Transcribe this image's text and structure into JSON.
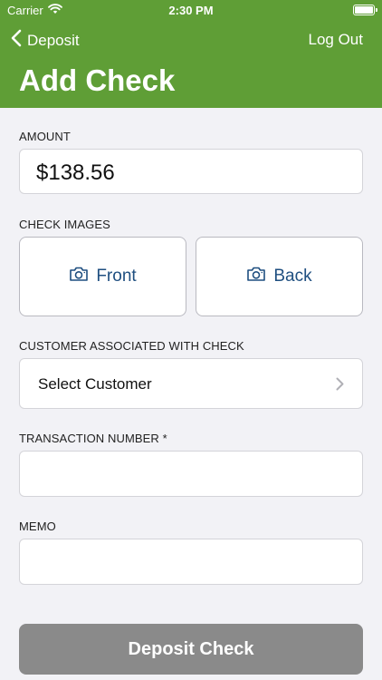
{
  "status_bar": {
    "carrier": "Carrier",
    "time": "2:30 PM"
  },
  "nav": {
    "back_label": "Deposit",
    "logout_label": "Log Out"
  },
  "page": {
    "title": "Add Check"
  },
  "amount": {
    "label": "AMOUNT",
    "value": "$138.56"
  },
  "check_images": {
    "label": "CHECK IMAGES",
    "front_label": "Front",
    "back_label": "Back"
  },
  "customer": {
    "label": "CUSTOMER ASSOCIATED WITH CHECK",
    "select_label": "Select Customer"
  },
  "transaction": {
    "label": "TRANSACTION NUMBER *",
    "value": ""
  },
  "memo": {
    "label": "MEMO",
    "value": ""
  },
  "deposit_button": {
    "label": "Deposit Check"
  },
  "colors": {
    "header": "#5f9e36",
    "accent_text": "#1f4f80",
    "button_disabled": "#8a8a8a",
    "background": "#f2f2f6"
  }
}
